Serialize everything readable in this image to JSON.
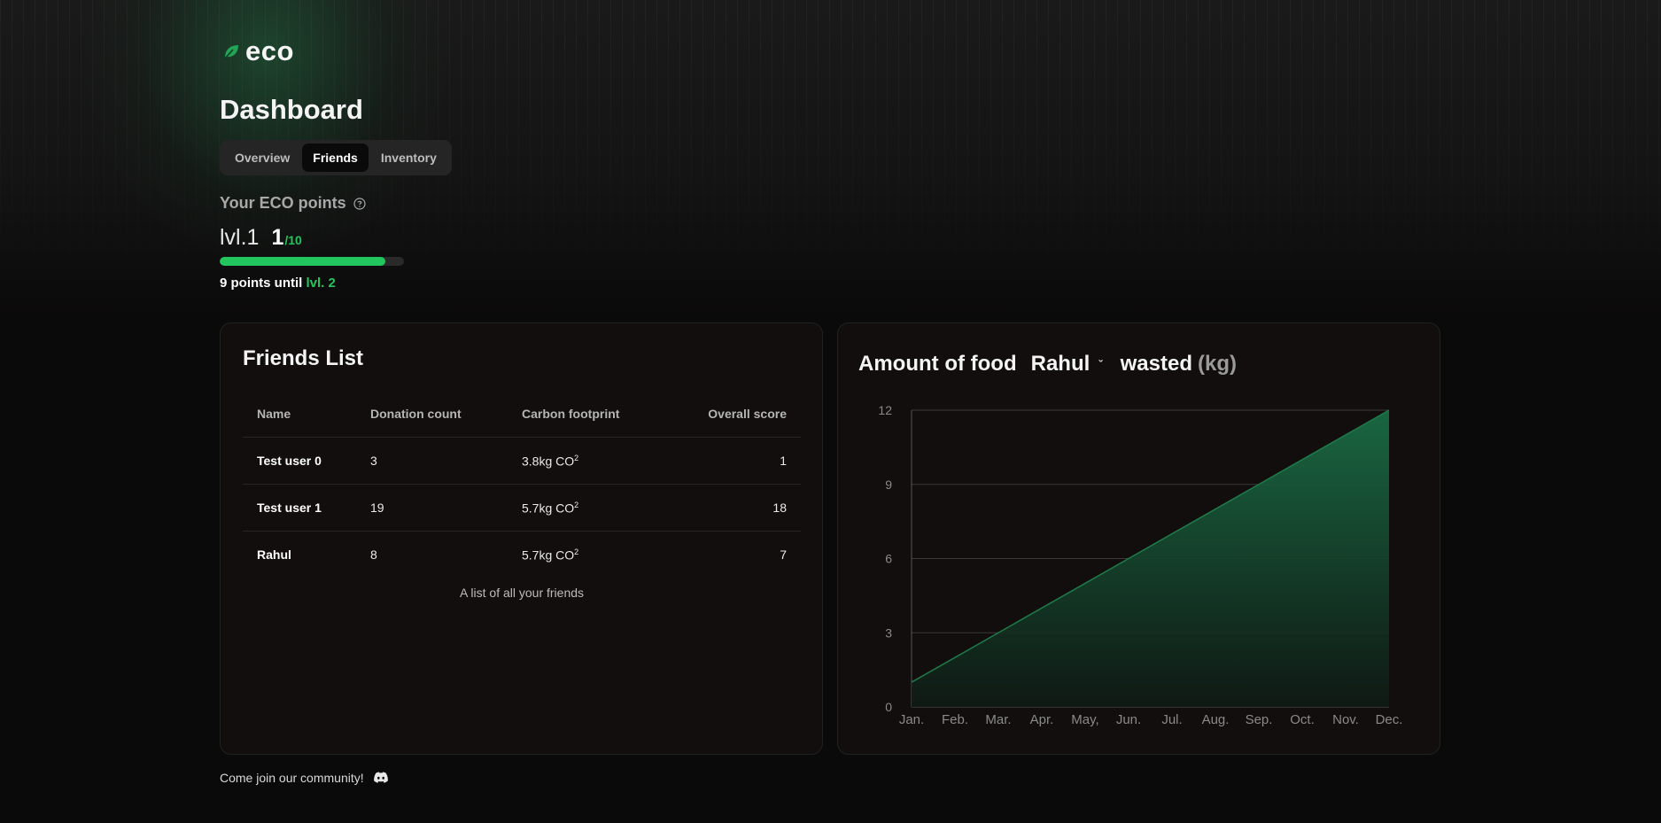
{
  "app": {
    "logo_text": "eco"
  },
  "page": {
    "title": "Dashboard"
  },
  "tabs": [
    {
      "label": "Overview",
      "active": false
    },
    {
      "label": "Friends",
      "active": true
    },
    {
      "label": "Inventory",
      "active": false
    }
  ],
  "eco_points": {
    "label": "Your ECO points",
    "help_icon": "question-circle-icon",
    "level_label": "lvl.1",
    "points": "1",
    "points_max": "/10",
    "progress_fraction": 0.9,
    "until_text": "9 points until",
    "next_level": "lvl. 2"
  },
  "friends": {
    "title": "Friends List",
    "columns": [
      "Name",
      "Donation count",
      "Carbon footprint",
      "Overall score"
    ],
    "rows": [
      {
        "name": "Test user 0",
        "donations": "3",
        "carbon": "3.8kg CO",
        "carbon_sup": "2",
        "score": "1"
      },
      {
        "name": "Test user 1",
        "donations": "19",
        "carbon": "5.7kg CO",
        "carbon_sup": "2",
        "score": "18"
      },
      {
        "name": "Rahul",
        "donations": "8",
        "carbon": "5.7kg CO",
        "carbon_sup": "2",
        "score": "7"
      }
    ],
    "caption": "A list of all your friends"
  },
  "chart_panel": {
    "title_prefix": "Amount of food",
    "selected_friend": "Rahul",
    "title_suffix": "wasted",
    "unit": "(kg)"
  },
  "chart_data": {
    "type": "area",
    "x": [
      "Jan.",
      "Feb.",
      "Mar.",
      "Apr.",
      "May,",
      "Jun.",
      "Jul.",
      "Aug.",
      "Sep.",
      "Oct.",
      "Nov.",
      "Dec."
    ],
    "series": [
      {
        "values": [
          1,
          2,
          3,
          4,
          5,
          6,
          7,
          8,
          9,
          10,
          11,
          12
        ]
      }
    ],
    "yticks": [
      0,
      3,
      6,
      9,
      12
    ],
    "ylim": [
      0,
      12
    ],
    "grid": true,
    "colors": {
      "line": "#1f7a4a",
      "fill_top": "#1a6b44",
      "fill_bottom": "#0f1a14"
    }
  },
  "footer": {
    "text": "Come join our community!",
    "icon": "discord-icon"
  },
  "colors": {
    "accent": "#22c55e",
    "card_bg": "#110e0d",
    "page_bg": "#0b0a0a"
  }
}
